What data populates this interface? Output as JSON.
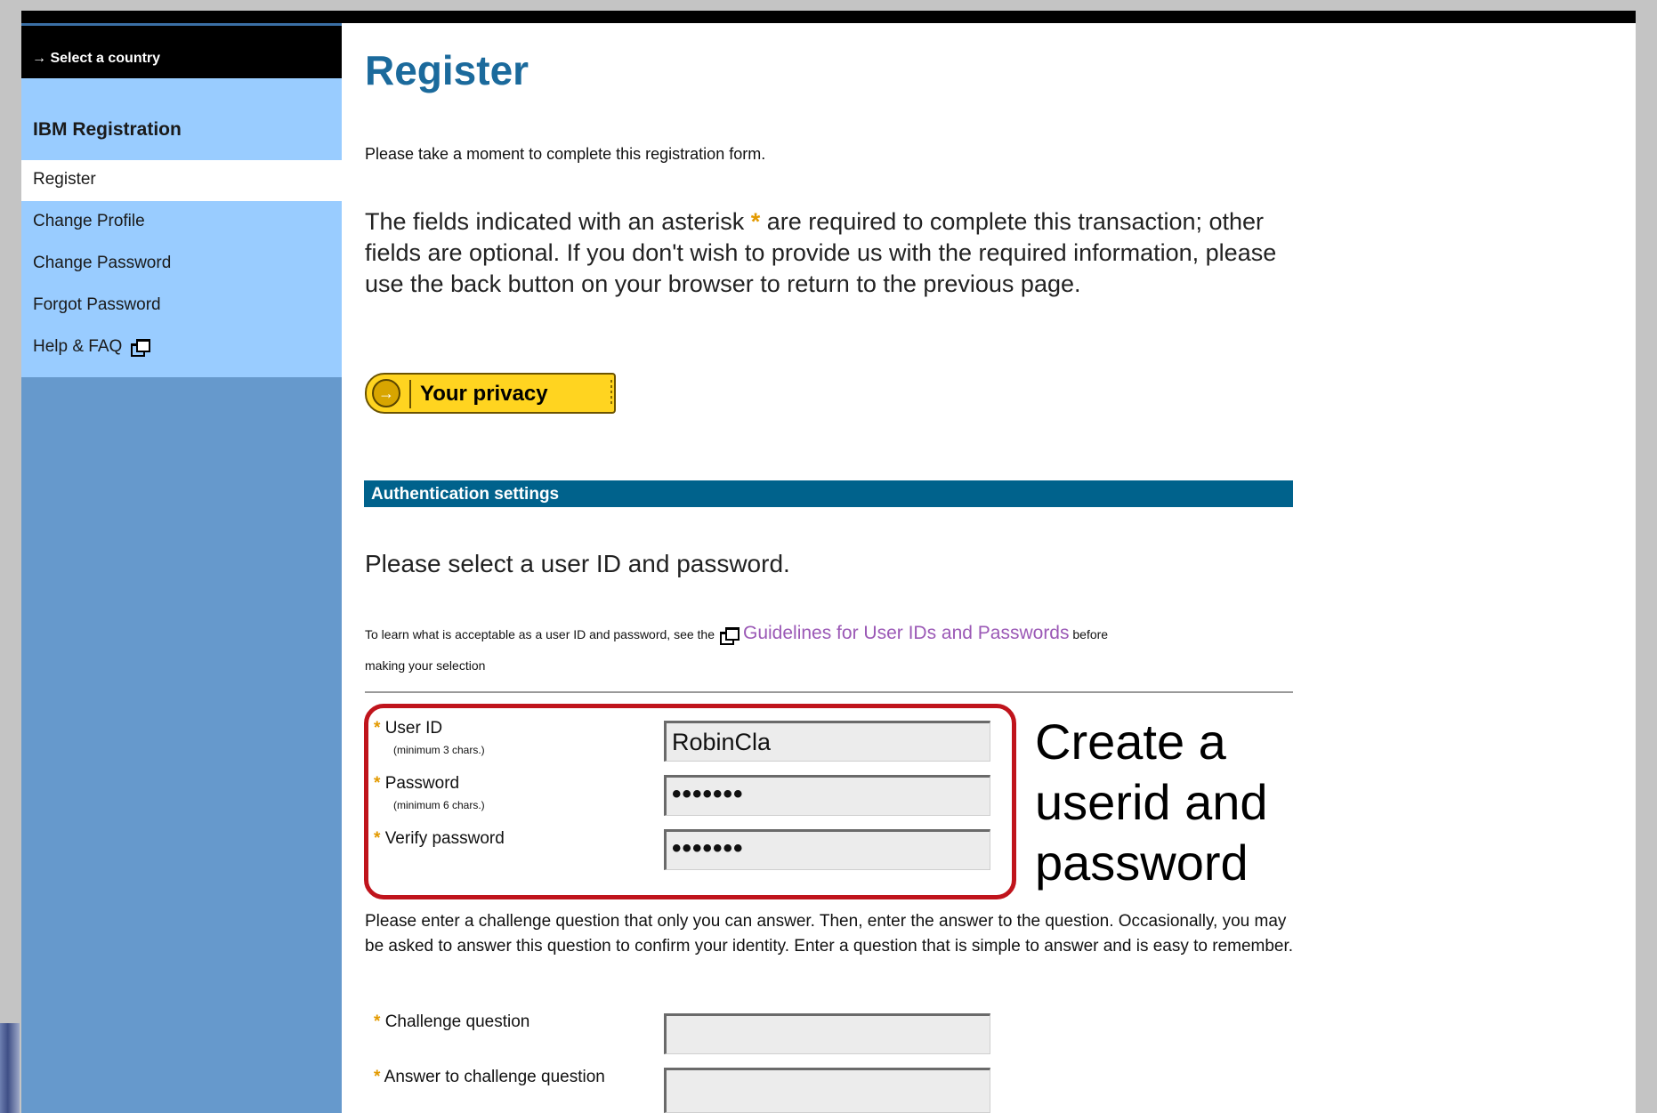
{
  "sidebar": {
    "select_country": "→ Select a country",
    "title": "IBM Registration",
    "items": [
      {
        "label": "Register"
      },
      {
        "label": "Change Profile"
      },
      {
        "label": "Change Password"
      },
      {
        "label": "Forgot Password"
      },
      {
        "label": "Help & FAQ"
      }
    ]
  },
  "main": {
    "title": "Register",
    "intro_small": "Please take a moment to complete this registration form.",
    "intro_large_before": "The fields indicated with an asterisk ",
    "intro_asterisk": "*",
    "intro_large_after": " are required to complete this transaction; other fields are optional. If you don't wish to provide us with the required information, please use the back button on your browser to return to the previous page.",
    "privacy_button": "Your privacy",
    "privacy_arrow": "→",
    "section_title": "Authentication settings",
    "select_prompt": "Please select a user ID and password.",
    "learn_prefix": "To learn what is acceptable as a user ID and password, see the",
    "learn_link": "Guidelines for User IDs and Passwords",
    "learn_suffix": "before",
    "learn_line2": "making your selection",
    "fields": {
      "userid": {
        "label": "User ID",
        "hint": "(minimum 3 chars.)",
        "value": "RobinCla"
      },
      "password": {
        "label": "Password",
        "hint": "(minimum 6 chars.)",
        "value": "•••••••"
      },
      "verify": {
        "label": "Verify password",
        "value": "•••••••"
      },
      "challenge_question": {
        "label": "Challenge question",
        "value": ""
      },
      "challenge_answer": {
        "label": "Answer to challenge question",
        "value": ""
      }
    },
    "required_mark": "*",
    "challenge_text": "Please enter a challenge question that only you can answer. Then, enter the answer to the question. Occasionally, you may be asked to answer this question to confirm your identity. Enter a question that is simple to answer and is easy to remember.",
    "annotation": {
      "line1": "Create a",
      "line2": "userid and",
      "line3": "password"
    }
  },
  "colors": {
    "sidebar_dark": "#6699cc",
    "sidebar_light": "#99ccff",
    "title_blue": "#1b6a9c",
    "section_bar": "#00628c",
    "asterisk": "#e39a00",
    "privacy_button": "#ffd420",
    "highlight_border": "#c0141c",
    "link": "#9b59b6"
  }
}
